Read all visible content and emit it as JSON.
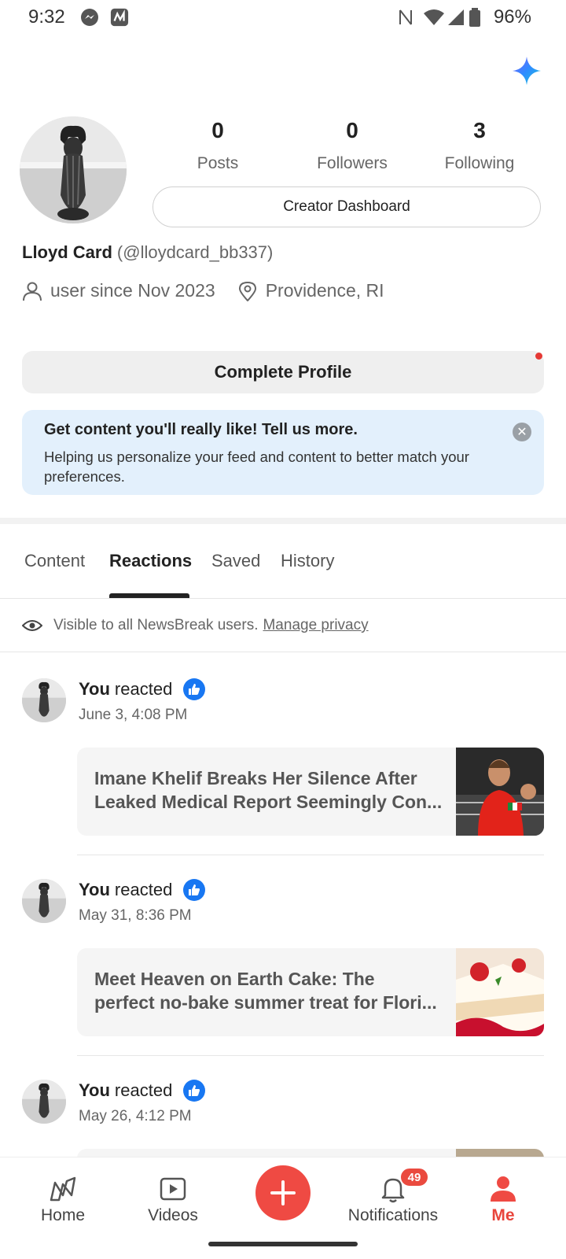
{
  "status_bar": {
    "time": "9:32",
    "battery": "96%"
  },
  "profile": {
    "stats": [
      {
        "value": "0",
        "label": "Posts"
      },
      {
        "value": "0",
        "label": "Followers"
      },
      {
        "value": "3",
        "label": "Following"
      }
    ],
    "creator_dashboard_label": "Creator Dashboard",
    "name": "Lloyd Card",
    "handle": "(@lloydcard_bb337)",
    "user_since": "user since Nov 2023",
    "location": "Providence, RI",
    "complete_profile_label": "Complete Profile"
  },
  "tip_banner": {
    "title": "Get content you'll really like! Tell us more.",
    "body": "Helping us personalize your feed and content to better match your preferences."
  },
  "tabs": [
    {
      "label": "Content"
    },
    {
      "label": "Reactions",
      "active": true
    },
    {
      "label": "Saved"
    },
    {
      "label": "History"
    }
  ],
  "visibility": {
    "text": "Visible to all NewsBreak users.",
    "link": "Manage privacy"
  },
  "feed": [
    {
      "you": "You",
      "action": "reacted",
      "date": "June 3, 4:08 PM",
      "title_line1": "Imane Khelif Breaks Her Silence After",
      "title_line2": "Leaked Medical Report Seemingly Con..."
    },
    {
      "you": "You",
      "action": "reacted",
      "date": "May 31, 8:36 PM",
      "title_line1": "Meet Heaven on Earth Cake: The",
      "title_line2": "perfect no-bake summer treat for Flori..."
    },
    {
      "you": "You",
      "action": "reacted",
      "date": "May 26, 4:12 PM"
    }
  ],
  "bottom_nav": {
    "items": [
      {
        "label": "Home"
      },
      {
        "label": "Videos"
      },
      {
        "label": "Notifications",
        "badge": "49"
      },
      {
        "label": "Me",
        "active": true
      }
    ]
  },
  "colors": {
    "accent": "#ef4a43",
    "like_blue": "#1877f2",
    "tip_bg": "#e3f0fc"
  }
}
